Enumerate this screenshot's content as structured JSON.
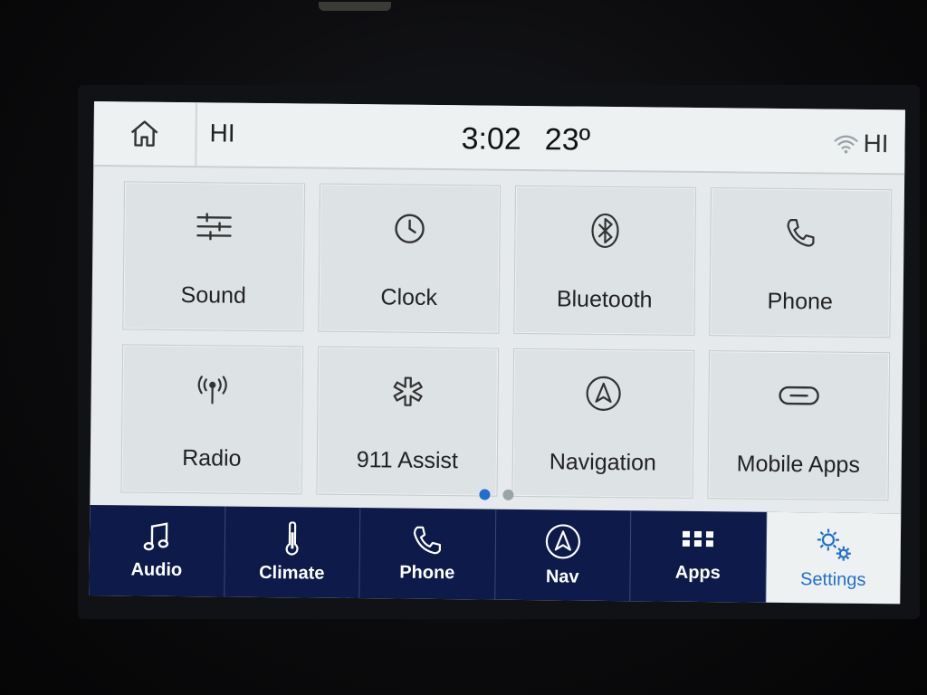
{
  "status": {
    "left_label": "HI",
    "time": "3:02",
    "temperature": "23º",
    "right_label": "HI"
  },
  "tiles": [
    {
      "label": "Sound",
      "icon": "sliders-icon"
    },
    {
      "label": "Clock",
      "icon": "clock-icon"
    },
    {
      "label": "Bluetooth",
      "icon": "bluetooth-icon"
    },
    {
      "label": "Phone",
      "icon": "phone-icon"
    },
    {
      "label": "Radio",
      "icon": "radio-antenna-icon"
    },
    {
      "label": "911 Assist",
      "icon": "star-of-life-icon"
    },
    {
      "label": "Navigation",
      "icon": "navigation-arrow-icon"
    },
    {
      "label": "Mobile Apps",
      "icon": "link-icon"
    }
  ],
  "pager": {
    "pages": 2,
    "current": 1
  },
  "nav": [
    {
      "label": "Audio",
      "icon": "music-note-icon"
    },
    {
      "label": "Climate",
      "icon": "thermometer-icon"
    },
    {
      "label": "Phone",
      "icon": "phone-icon"
    },
    {
      "label": "Nav",
      "icon": "navigation-arrow-icon"
    },
    {
      "label": "Apps",
      "icon": "apps-grid-icon"
    },
    {
      "label": "Settings",
      "icon": "gears-icon"
    }
  ],
  "colors": {
    "accent": "#1f6fd0",
    "nav_bar": "#0d1a4a",
    "screen_bg": "#e6eaec"
  }
}
